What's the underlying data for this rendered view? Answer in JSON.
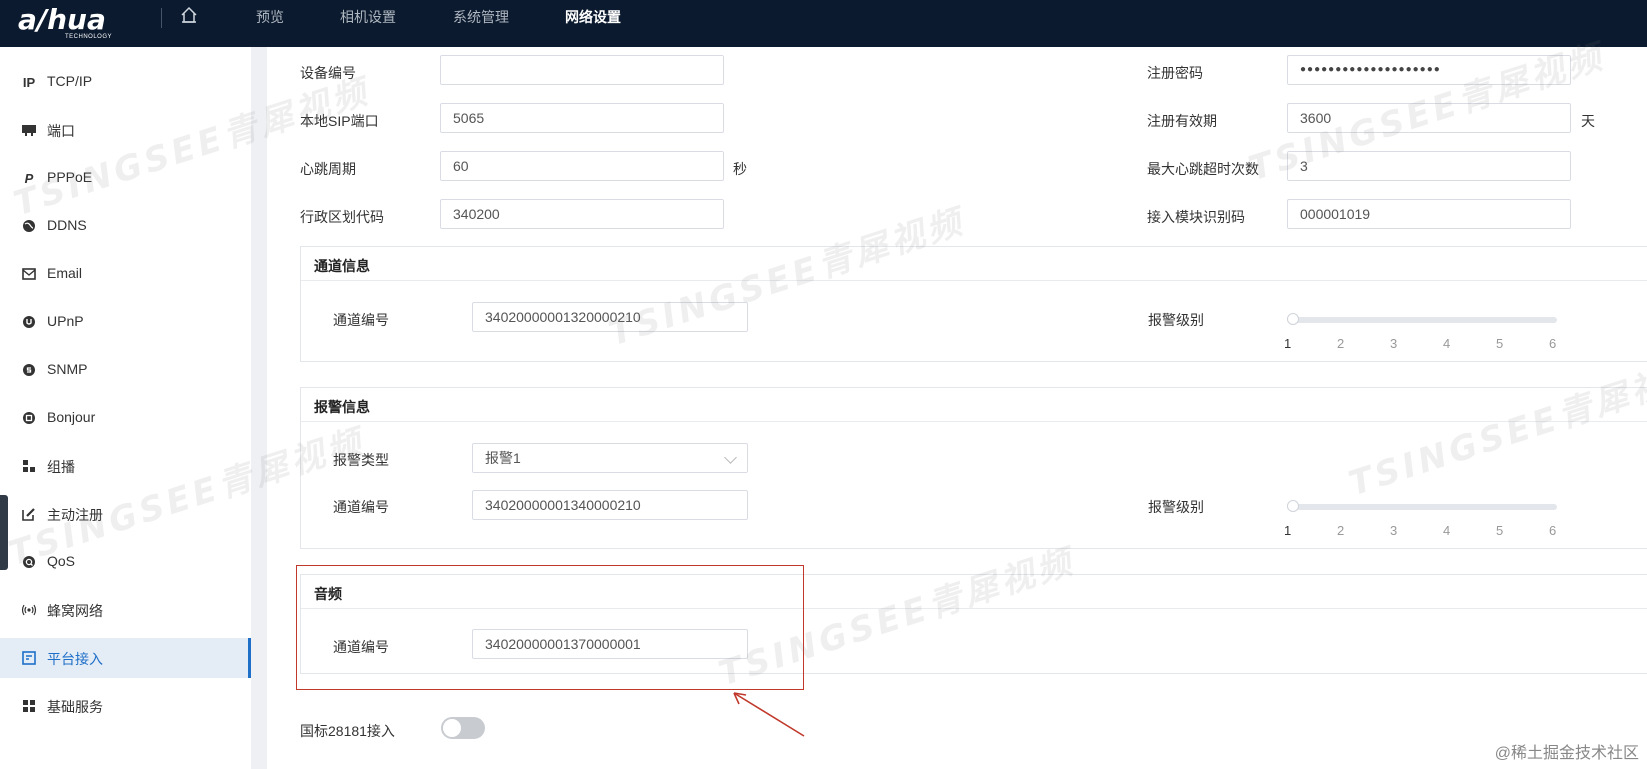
{
  "nav": {
    "logo_text": "a/hua",
    "logo_sub": "TECHNOLOGY",
    "items": [
      "预览",
      "相机设置",
      "系统管理",
      "网络设置"
    ],
    "active_index": 3
  },
  "sidebar": {
    "items": [
      {
        "icon": "ip-icon",
        "label": "TCP/IP"
      },
      {
        "icon": "port-icon",
        "label": "端口"
      },
      {
        "icon": "pppoe-icon",
        "label": "PPPoE"
      },
      {
        "icon": "globe-icon",
        "label": "DDNS"
      },
      {
        "icon": "mail-icon",
        "label": "Email"
      },
      {
        "icon": "upnp-icon",
        "label": "UPnP"
      },
      {
        "icon": "snmp-icon",
        "label": "SNMP"
      },
      {
        "icon": "bonjour-icon",
        "label": "Bonjour"
      },
      {
        "icon": "multicast-icon",
        "label": "组播"
      },
      {
        "icon": "edit-icon",
        "label": "主动注册"
      },
      {
        "icon": "qos-icon",
        "label": "QoS"
      },
      {
        "icon": "cellular-icon",
        "label": "蜂窝网络"
      },
      {
        "icon": "platform-icon",
        "label": "平台接入"
      },
      {
        "icon": "grid-icon",
        "label": "基础服务"
      }
    ],
    "active_index": 12
  },
  "form": {
    "device_id": {
      "label": "设备编号",
      "value": ""
    },
    "local_sip_port": {
      "label": "本地SIP端口",
      "value": "5065"
    },
    "heartbeat": {
      "label": "心跳周期",
      "value": "60",
      "unit": "秒"
    },
    "admin_code": {
      "label": "行政区划代码",
      "value": "340200"
    },
    "reg_password": {
      "label": "注册密码",
      "value": "●●●●●●●●●●●●●●●●●●●●"
    },
    "reg_validity": {
      "label": "注册有效期",
      "value": "3600",
      "unit": "天"
    },
    "max_heartbeat_timeouts": {
      "label": "最大心跳超时次数",
      "value": "3"
    },
    "module_id": {
      "label": "接入模块识别码",
      "value": "000001019"
    }
  },
  "channel_info": {
    "title": "通道信息",
    "channel_label": "通道编号",
    "channel_value": "34020000001320000210",
    "alarm_level_label": "报警级别",
    "alarm_level_value": 1,
    "ticks": [
      "1",
      "2",
      "3",
      "4",
      "5",
      "6"
    ]
  },
  "alarm_info": {
    "title": "报警信息",
    "type_label": "报警类型",
    "type_value": "报警1",
    "channel_label": "通道编号",
    "channel_value": "34020000001340000210",
    "alarm_level_label": "报警级别",
    "alarm_level_value": 1,
    "ticks": [
      "1",
      "2",
      "3",
      "4",
      "5",
      "6"
    ]
  },
  "audio": {
    "title": "音频",
    "channel_label": "通道编号",
    "channel_value": "34020000001370000001"
  },
  "gb28181": {
    "label": "国标28181接入",
    "enabled": false
  },
  "watermarks": {
    "brand": "TSINGSEE青犀视频",
    "corner": "@稀土掘金技术社区"
  },
  "colors": {
    "topbar": "#0b1a2e",
    "accent": "#1e6fc8",
    "annotation": "#c0392b"
  }
}
